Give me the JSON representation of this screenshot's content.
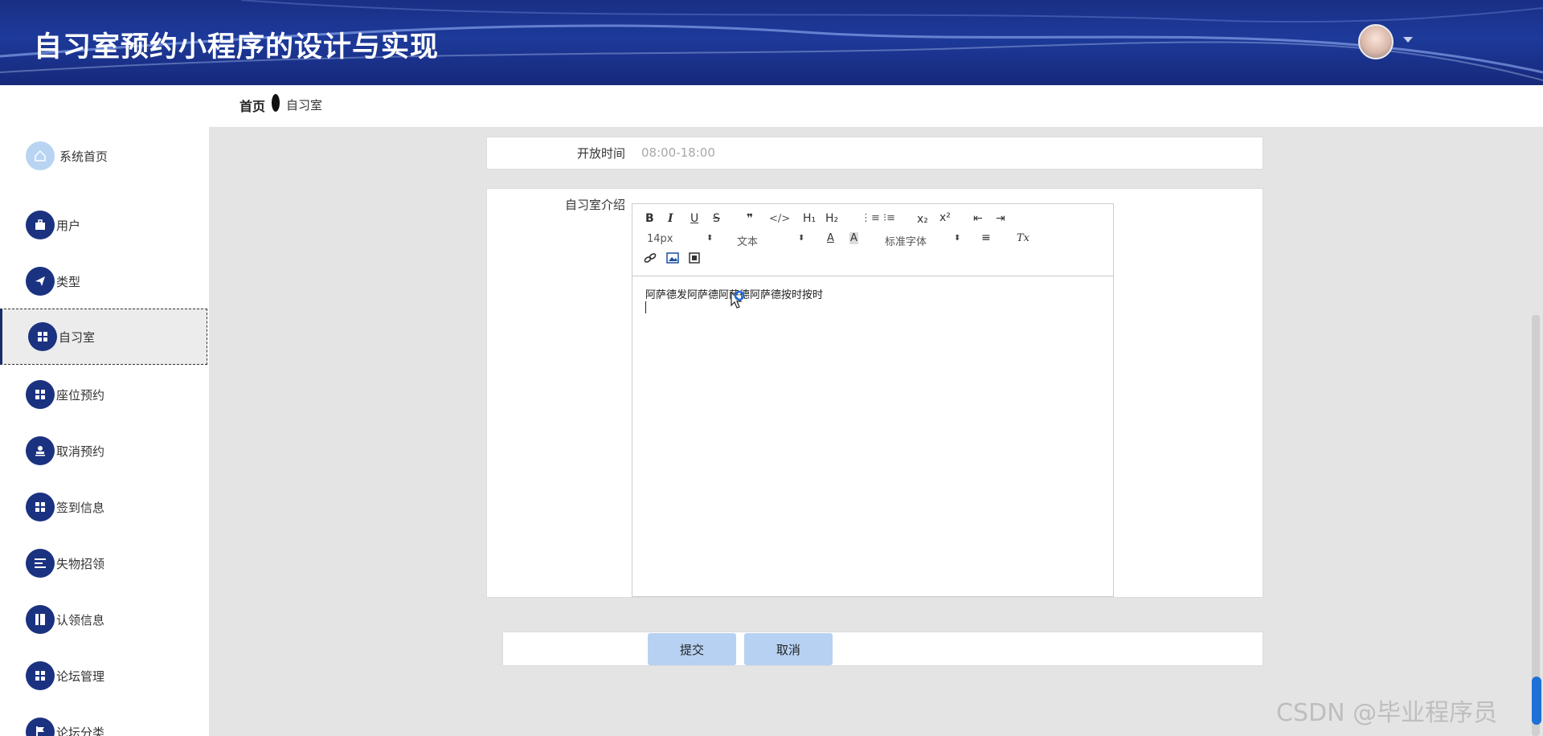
{
  "app": {
    "title": "自习室预约小程序的设计与实现"
  },
  "breadcrumb": {
    "home": "首页",
    "current": "自习室"
  },
  "sidebar": {
    "items": [
      {
        "label": "系统首页",
        "icon": "home-icon"
      },
      {
        "label": "用户",
        "icon": "briefcase-icon"
      },
      {
        "label": "类型",
        "icon": "paper-plane-icon"
      },
      {
        "label": "自习室",
        "icon": "grid-icon",
        "active": true
      },
      {
        "label": "座位预约",
        "icon": "grid-icon"
      },
      {
        "label": "取消预约",
        "icon": "stamp-icon"
      },
      {
        "label": "签到信息",
        "icon": "grid-icon"
      },
      {
        "label": "失物招领",
        "icon": "list-icon"
      },
      {
        "label": "认领信息",
        "icon": "book-icon"
      },
      {
        "label": "论坛管理",
        "icon": "grid-icon"
      },
      {
        "label": "论坛分类",
        "icon": "flag-icon"
      }
    ]
  },
  "form": {
    "open_time": {
      "label": "开放时间",
      "placeholder": "08:00-18:00"
    },
    "intro": {
      "label": "自习室介绍",
      "content": "阿萨德发阿萨德阿萨德阿萨德按时按时"
    }
  },
  "editor_toolbar": {
    "bold": "B",
    "italic": "I",
    "underline": "U",
    "strike": "S",
    "quote": "❞",
    "code": "</>",
    "h1": "H₁",
    "h2": "H₂",
    "ordered_list": "⋮≡",
    "bullet_list": "⁝≡",
    "subscript": "x₂",
    "superscript": "x²",
    "outdent": "⇤",
    "indent": "⇥",
    "size": "14px",
    "header": "文本",
    "font_color": "A",
    "bg_color": "A",
    "font": "标准字体",
    "align": "≡",
    "clean": "Tx"
  },
  "buttons": {
    "submit": "提交",
    "cancel": "取消"
  },
  "watermark": "CSDN @毕业程序员"
}
